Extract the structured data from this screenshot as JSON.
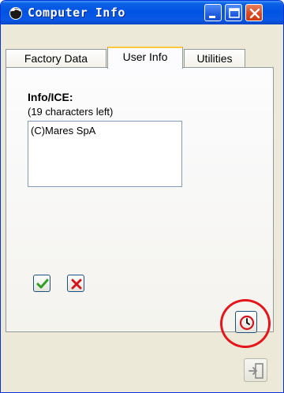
{
  "window": {
    "title": "Computer Info"
  },
  "tabs": [
    {
      "label": "Factory Data",
      "active": false
    },
    {
      "label": "User Info",
      "active": true
    },
    {
      "label": "Utilities",
      "active": false
    }
  ],
  "user_info": {
    "heading": "Info/ICE:",
    "chars_left": "(19 characters left)",
    "value": "(C)Mares SpA"
  },
  "icons": {
    "app": "app-dive-icon",
    "ok": "check-icon",
    "cancel": "x-icon",
    "clock": "clock-icon",
    "exit": "exit-icon"
  },
  "colors": {
    "titlebar": "#0054e3",
    "ok_green": "#2e9e25",
    "cancel_red": "#d4141b",
    "highlight": "#e4161b"
  }
}
